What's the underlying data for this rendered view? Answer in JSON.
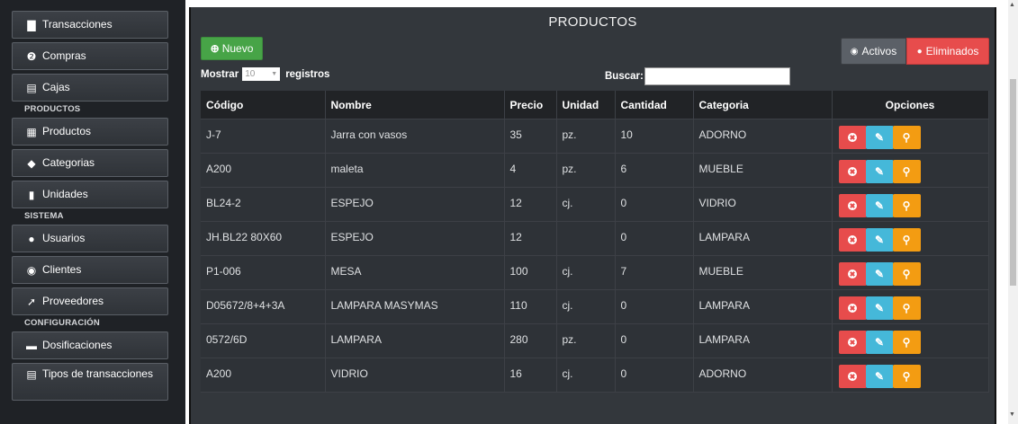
{
  "sidebar": {
    "items_top": [
      {
        "label": "Transacciones",
        "icon": "▇",
        "icon_name": "receipt-icon"
      },
      {
        "label": "Compras",
        "icon": "❷",
        "icon_name": "globe-icon"
      },
      {
        "label": "Cajas",
        "icon": "▤",
        "icon_name": "briefcase-icon"
      }
    ],
    "section_products": "PRODUCTOS",
    "items_products": [
      {
        "label": "Productos",
        "icon": "▦",
        "icon_name": "products-icon"
      },
      {
        "label": "Categorias",
        "icon": "◆",
        "icon_name": "tags-icon"
      },
      {
        "label": "Unidades",
        "icon": "▮",
        "icon_name": "bookmark-icon"
      }
    ],
    "section_system": "SISTEMA",
    "items_system": [
      {
        "label": "Usuarios",
        "icon": "●",
        "icon_name": "user-icon"
      },
      {
        "label": "Clientes",
        "icon": "◉",
        "icon_name": "eye-icon"
      },
      {
        "label": "Proveedores",
        "icon": "➚",
        "icon_name": "leaf-icon"
      }
    ],
    "section_config": "CONFIGURACIÓN",
    "items_config": [
      {
        "label": "Dosificaciones",
        "icon": "▬",
        "icon_name": "folder-icon"
      },
      {
        "label": "Tipos de transacciones",
        "icon": "▤",
        "icon_name": "list-icon"
      }
    ]
  },
  "main": {
    "title": "PRODUCTOS",
    "new_button": "Nuevo",
    "show_label_before": "Mostrar",
    "show_value": "10",
    "show_label_after": "registros",
    "search_label": "Buscar:",
    "search_value": "",
    "filter_active": "Activos",
    "filter_deleted": "Eliminados"
  },
  "table": {
    "columns": [
      "Código",
      "Nombre",
      "Precio",
      "Unidad",
      "Cantidad",
      "Categoria",
      "Opciones"
    ],
    "rows": [
      [
        "J-7",
        "Jarra con vasos",
        "35",
        "pz.",
        "10",
        "ADORNO"
      ],
      [
        "A200",
        "maleta",
        "4",
        "pz.",
        "6",
        "MUEBLE"
      ],
      [
        "BL24-2",
        "ESPEJO",
        "12",
        "cj.",
        "0",
        "VIDRIO"
      ],
      [
        "JH.BL22 80X60",
        "ESPEJO",
        "12",
        "",
        "0",
        "LAMPARA"
      ],
      [
        "P1-006",
        "MESA",
        "100",
        "cj.",
        "7",
        "MUEBLE"
      ],
      [
        "D05672/8+4+3A",
        "LAMPARA MASYMAS",
        "110",
        "cj.",
        "0",
        "LAMPARA"
      ],
      [
        "0572/6D",
        "LAMPARA",
        "280",
        "pz.",
        "0",
        "LAMPARA"
      ],
      [
        "A200",
        "VIDRIO",
        "16",
        "cj.",
        "0",
        "ADORNO"
      ]
    ]
  },
  "colors": {
    "sidebar_bg": "#1f2226",
    "main_bg": "#33373c",
    "success": "#47a447",
    "danger": "#e74c4c",
    "info": "#45b8d9",
    "warning": "#f39c12"
  }
}
